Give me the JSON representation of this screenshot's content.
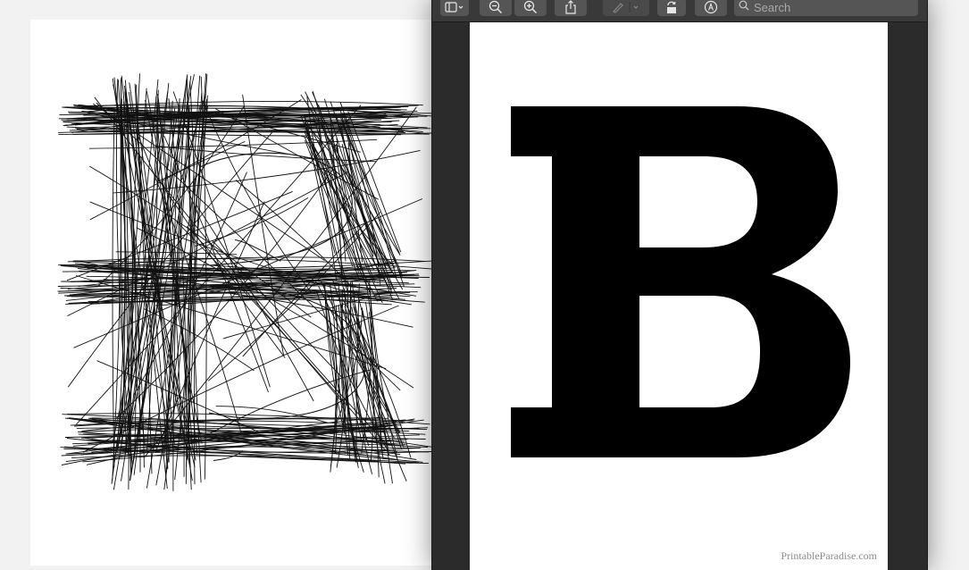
{
  "toolbar": {
    "buttons": [
      {
        "name": "sidebar-toggle",
        "icon": "sidebar-icon"
      },
      {
        "name": "zoom-out",
        "icon": "zoom-out-icon"
      },
      {
        "name": "zoom-in",
        "icon": "zoom-in-icon"
      },
      {
        "name": "share",
        "icon": "share-icon"
      },
      {
        "name": "markup-pen",
        "icon": "pen-icon"
      },
      {
        "name": "rotate",
        "icon": "rotate-icon"
      },
      {
        "name": "markup-toolbar",
        "icon": "markup-circle-icon"
      }
    ],
    "search_placeholder": "Search"
  },
  "document": {
    "letter": "B",
    "watermark": "PrintableParadise.com"
  },
  "colors": {
    "window_bg": "#2b2b2b",
    "toolbar_bg": "#393939",
    "button_bg": "#555555",
    "page_bg": "#ffffff",
    "ink": "#000000"
  }
}
